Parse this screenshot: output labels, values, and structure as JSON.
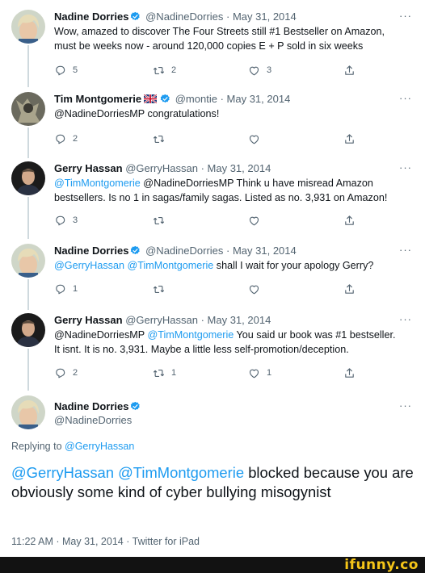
{
  "tweets": [
    {
      "name": "Nadine Dorries",
      "handle": "@NadineDorries",
      "date": "· May 31, 2014",
      "more": "···",
      "body_line1": "Wow, amazed to discover The Four Streets still #1 Bestseller on Amazon,",
      "body_line2": "must be weeks now - around 120,000 copies  E + P sold in six weeks",
      "replies": "5",
      "retweets": "2",
      "likes": "3"
    },
    {
      "name": "Tim Montgomerie",
      "handle": "@montie",
      "date": "· May 31, 2014",
      "more": "···",
      "body_line1": "@NadineDorriesMP congratulations!",
      "replies": "2",
      "retweets": "",
      "likes": ""
    },
    {
      "name": "Gerry Hassan",
      "handle": "@GerryHassan",
      "date": "· May 31, 2014",
      "more": "···",
      "mention1": "@TimMontgomerie",
      "body_line1_rest": " @NadineDorriesMP Think u have misread Amazon",
      "body_line2": "bestsellers. Is no 1 in sagas/family sagas. Listed as no. 3,931 on Amazon!",
      "replies": "3",
      "retweets": "",
      "likes": ""
    },
    {
      "name": "Nadine Dorries",
      "handle": "@NadineDorries",
      "date": "· May 31, 2014",
      "more": "···",
      "mention1": "@GerryHassan",
      "mention2": "@TimMontgomerie",
      "body_line1_rest": " shall I wait for your apology Gerry?",
      "replies": "1",
      "retweets": "",
      "likes": ""
    },
    {
      "name": "Gerry Hassan",
      "handle": "@GerryHassan",
      "date": "· May 31, 2014",
      "more": "···",
      "body_lead": "@NadineDorriesMP ",
      "mention1": "@TimMontgomerie",
      "body_line1_rest": " You said ur book was #1 bestseller.",
      "body_line2": "It isnt. It is no. 3,931. Maybe a little less self-promotion/deception.",
      "replies": "2",
      "retweets": "1",
      "likes": "1"
    }
  ],
  "main_tweet": {
    "name": "Nadine Dorries",
    "handle": "@NadineDorries",
    "more": "···",
    "replying_label": "Replying to ",
    "replying_mention": "@GerryHassan",
    "mention1": "@GerryHassan",
    "mention2": "@TimMontgomerie",
    "text_rest": " blocked because you are obviously some kind of cyber bullying misogynist",
    "timestamp": "11:22 AM · May 31, 2014 · Twitter for iPad"
  },
  "footer": {
    "brand": "ifunny.co"
  },
  "colors": {
    "accent": "#1d9bf0",
    "muted": "#536471",
    "brand": "#f5c518"
  }
}
